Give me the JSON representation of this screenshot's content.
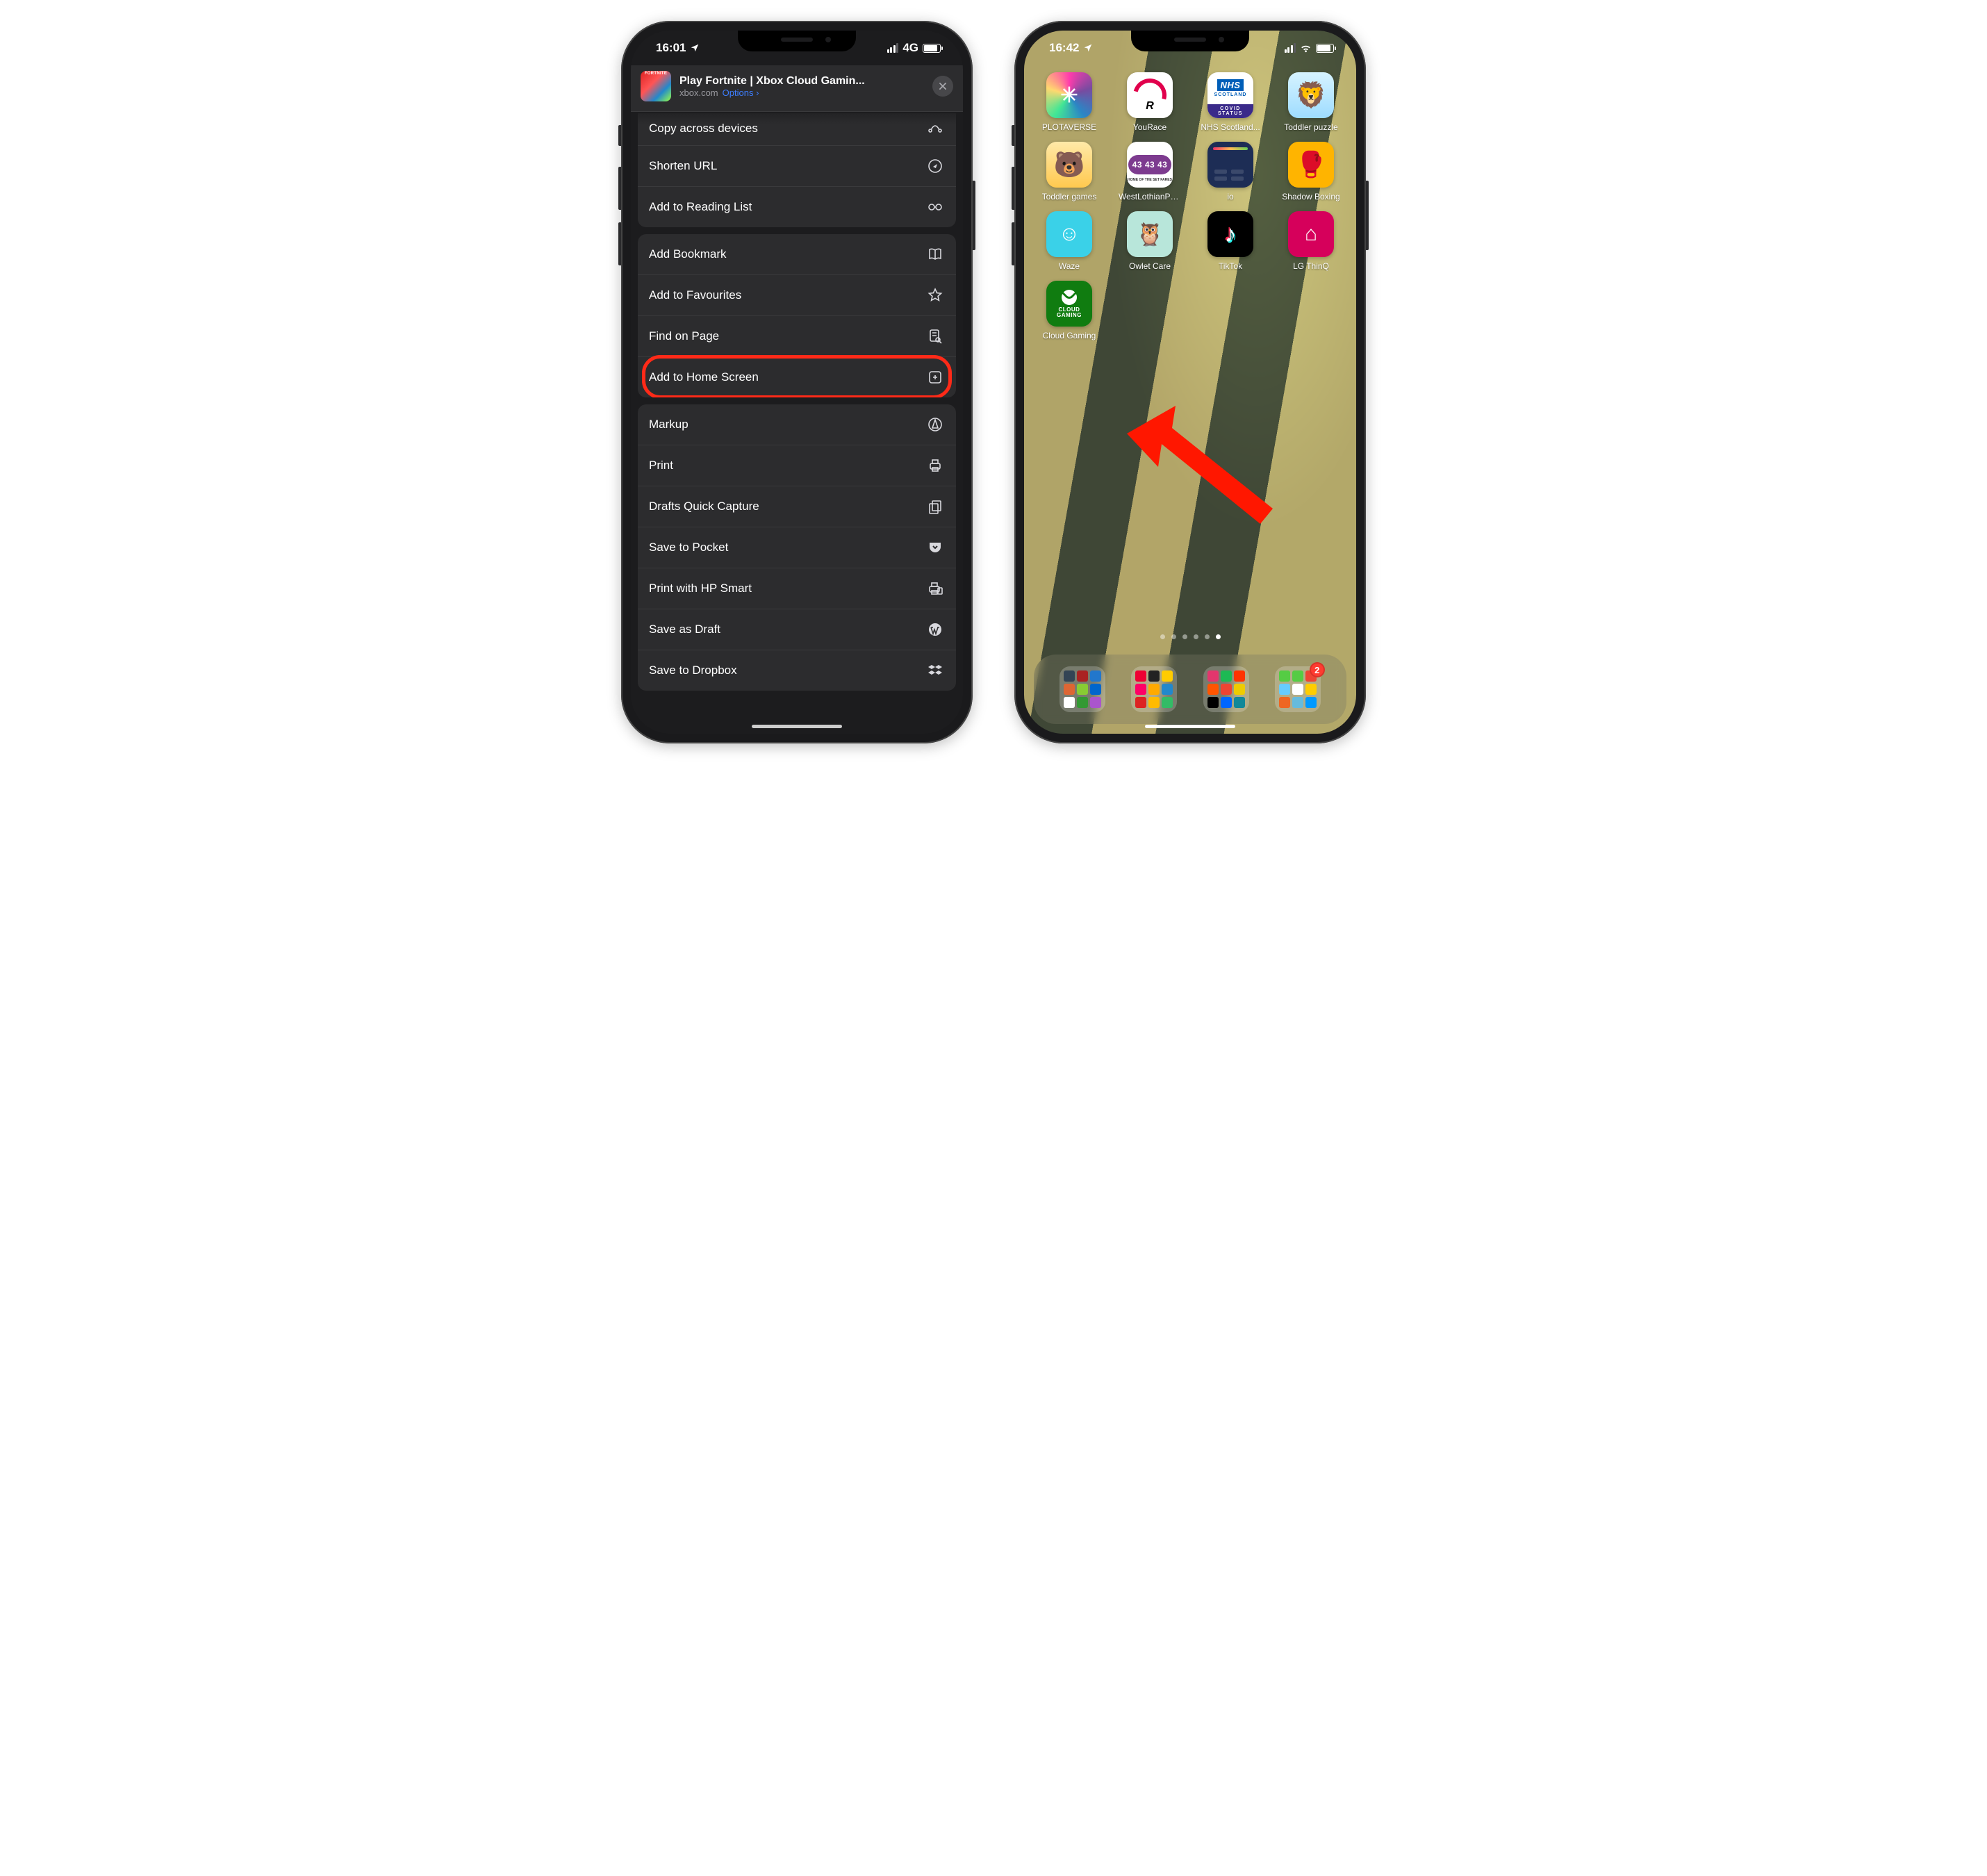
{
  "left": {
    "status": {
      "time": "16:01",
      "net": "4G"
    },
    "share_header": {
      "title": "Play Fortnite | Xbox Cloud Gamin...",
      "domain": "xbox.com",
      "options_label": "Options"
    },
    "groups": [
      [
        {
          "label": "Copy across devices",
          "icon": "share-devices-icon",
          "peek": true
        },
        {
          "label": "Shorten URL",
          "icon": "compass-icon"
        },
        {
          "label": "Add to Reading List",
          "icon": "glasses-icon"
        }
      ],
      [
        {
          "label": "Add Bookmark",
          "icon": "book-icon"
        },
        {
          "label": "Add to Favourites",
          "icon": "star-icon"
        },
        {
          "label": "Find on Page",
          "icon": "doc-search-icon"
        },
        {
          "label": "Add to Home Screen",
          "icon": "plus-square-icon",
          "highlight": true
        }
      ],
      [
        {
          "label": "Markup",
          "icon": "markup-icon"
        },
        {
          "label": "Print",
          "icon": "printer-icon"
        },
        {
          "label": "Drafts Quick Capture",
          "icon": "stack-icon"
        },
        {
          "label": "Save to Pocket",
          "icon": "pocket-icon"
        },
        {
          "label": "Print with HP Smart",
          "icon": "hp-print-icon"
        },
        {
          "label": "Save as Draft",
          "icon": "wordpress-icon"
        },
        {
          "label": "Save to Dropbox",
          "icon": "dropbox-icon"
        }
      ]
    ]
  },
  "right": {
    "status": {
      "time": "16:42"
    },
    "apps": [
      {
        "label": "PLOTAVERSE",
        "icon": "ic-plotaverse"
      },
      {
        "label": "YouRace",
        "icon": "ic-yourace"
      },
      {
        "label": "NHS Scotland...",
        "icon": "ic-nhs"
      },
      {
        "label": "Toddler puzzle",
        "icon": "ic-toddlerp"
      },
      {
        "label": "Toddler games",
        "icon": "ic-toddlerg"
      },
      {
        "label": "WestLothianPri...",
        "icon": "ic-westlo"
      },
      {
        "label": "io",
        "icon": "ic-io"
      },
      {
        "label": "Shadow Boxing",
        "icon": "ic-shadow"
      },
      {
        "label": "Waze",
        "icon": "ic-waze"
      },
      {
        "label": "Owlet Care",
        "icon": "ic-owlet"
      },
      {
        "label": "TikTok",
        "icon": "ic-tiktok"
      },
      {
        "label": "LG ThinQ",
        "icon": "ic-lg"
      },
      {
        "label": "Cloud Gaming",
        "icon": "ic-cloud",
        "arrow_target": true
      }
    ],
    "nhs": {
      "brand": "NHS",
      "sub": "SCOTLAND",
      "foot": "COVID STATUS"
    },
    "westlothian": {
      "big": "43 43 43"
    },
    "cloud": {
      "line1": "CLOUD",
      "line2": "GAMING"
    },
    "page_dots": {
      "count": 6,
      "current_index": 5
    },
    "dock_badge": "2"
  }
}
